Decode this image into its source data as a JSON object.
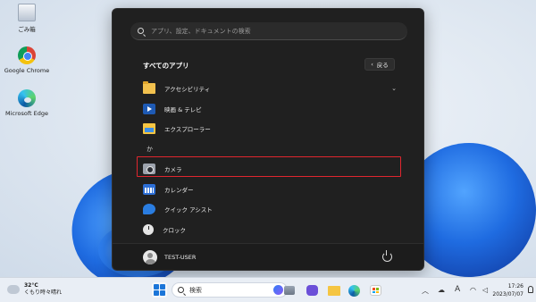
{
  "desktop": {
    "icons": [
      {
        "label": "ごみ箱",
        "icon": "recycle-bin-icon"
      },
      {
        "label": "Google Chrome",
        "icon": "chrome-icon"
      },
      {
        "label": "Microsoft Edge",
        "icon": "edge-icon"
      }
    ]
  },
  "start_menu": {
    "search_placeholder": "アプリ、設定、ドキュメントの検索",
    "all_apps_title": "すべてのアプリ",
    "back_button": {
      "chevron": "‹",
      "label": "戻る"
    },
    "apps": [
      {
        "label": "アクセシビリティ",
        "icon": "folder-icon",
        "expandable": true
      },
      {
        "label": "映画 & テレビ",
        "icon": "movies-tv-icon"
      },
      {
        "label": "エクスプローラー",
        "icon": "file-explorer-icon"
      }
    ],
    "section_letter": "か",
    "apps_ka": [
      {
        "label": "カメラ",
        "icon": "camera-icon",
        "highlighted": true
      },
      {
        "label": "カレンダー",
        "icon": "calendar-icon"
      },
      {
        "label": "クイック アシスト",
        "icon": "quick-assist-icon"
      },
      {
        "label": "クロック",
        "icon": "clock-icon"
      }
    ],
    "user_name": "TEST-USER",
    "highlight_color": "#e0262e"
  },
  "taskbar": {
    "weather_temp": "32°C",
    "weather_desc": "くもり時々晴れ",
    "search_label": "検索",
    "tray_ime": "A",
    "time": "17:26",
    "date": "2023/07/07"
  }
}
